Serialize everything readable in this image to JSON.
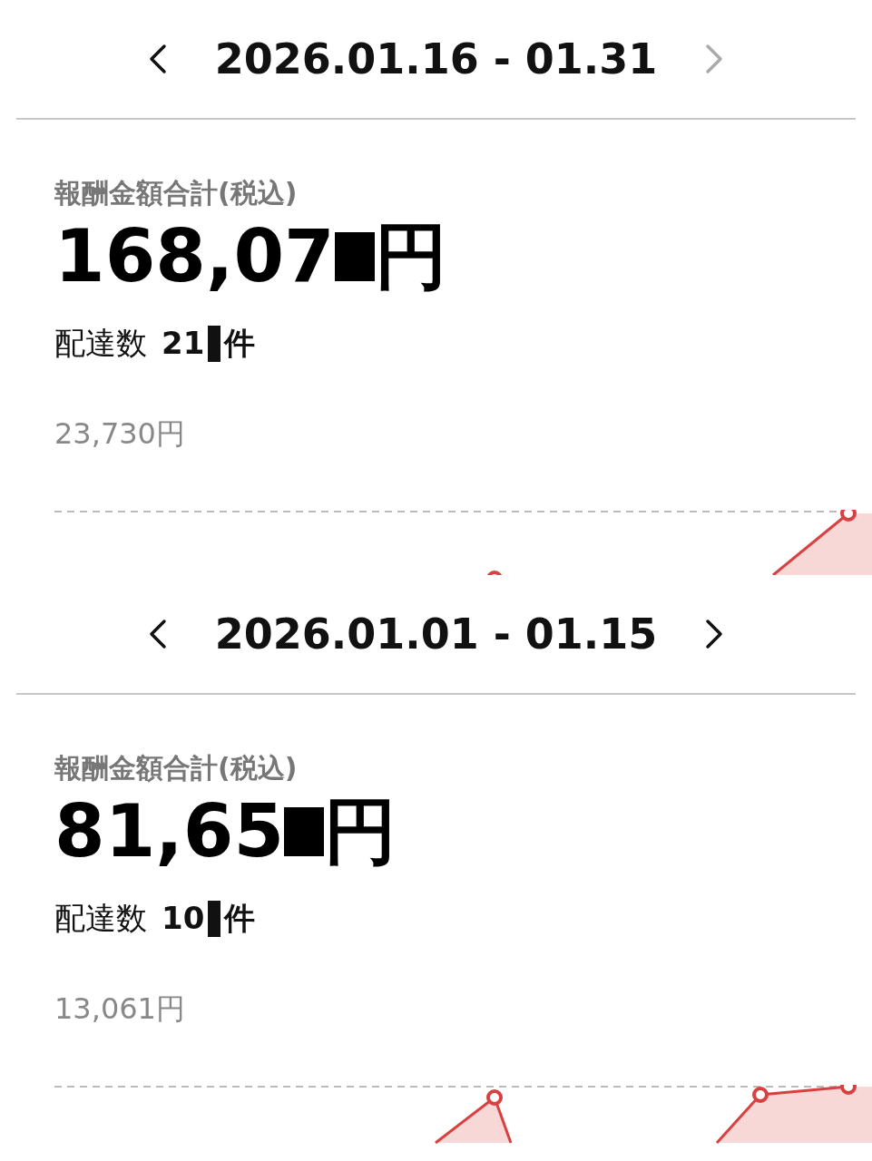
{
  "periods": [
    {
      "range": "2026.01.16 - 01.31",
      "next_disabled": true,
      "label": "報酬金額合計(税込)",
      "amount": "168,07",
      "amount_unit": "円",
      "count_label": "配達数",
      "count": "21",
      "count_unit": "件",
      "reference_value": "23,730円"
    },
    {
      "range": "2026.01.01 - 01.15",
      "next_disabled": false,
      "label": "報酬金額合計(税込)",
      "amount": "81,65",
      "amount_unit": "円",
      "count_label": "配達数",
      "count": "10",
      "count_unit": "件",
      "reference_value": "13,061円"
    }
  ]
}
